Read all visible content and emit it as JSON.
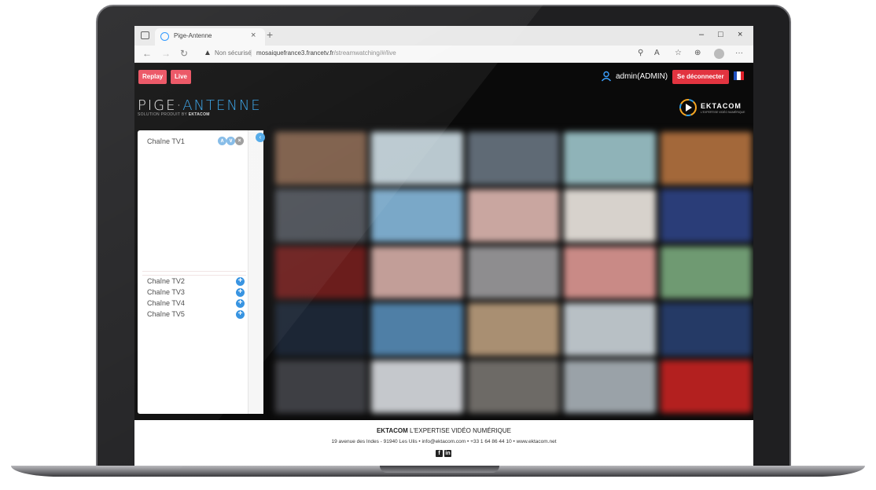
{
  "browser": {
    "tab_title": "Pige-Antenne",
    "tab_close": "×",
    "new_tab": "+",
    "security_label": "Non sécurisé",
    "url_host": "mosaiquefrance3.francetv.fr",
    "url_path": "/streamwatching/#/live",
    "window_controls": [
      "–",
      "□",
      "×"
    ]
  },
  "header": {
    "replay_label": "Replay",
    "live_label": "Live",
    "user_label": "admin(ADMIN)",
    "logout_label": "Se déconnecter",
    "flag_colors": [
      "#1f4fbf",
      "#ffffff",
      "#e0202a"
    ]
  },
  "brand": {
    "name_part1": "PIGE·",
    "name_part2": "ANTENNE",
    "tagline_prefix": "SOLUTION PRODUIT BY ",
    "tagline_brand": "EKTACOM",
    "partner_name": "EKTACOM",
    "partner_tagline": "L'EXPERTISE VIDÉO NUMÉRIQUE",
    "accent_color": "#2f9ee6"
  },
  "channels": {
    "active": "Chaîne TV1",
    "available": [
      {
        "label": "Chaîne TV2"
      },
      {
        "label": "Chaîne TV3"
      },
      {
        "label": "Chaîne TV4"
      },
      {
        "label": "Chaîne TV5"
      }
    ]
  },
  "footer": {
    "company": "EKTACOM",
    "tagline": " L'EXPERTISE VIDÉO NUMÉRIQUE",
    "address": "19 avenue des Indes - 91940 Les Ulis • info@ektacom.com • +33 1 64 86 44 10 • www.ektacom.net",
    "social_icons": [
      "facebook-icon",
      "linkedin-icon"
    ]
  }
}
